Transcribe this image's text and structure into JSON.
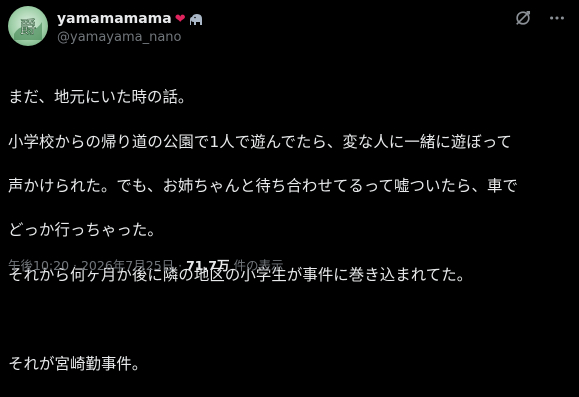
{
  "author": {
    "display_name": "yamamamama",
    "handle": "@yamayama_nano",
    "badges": [
      "heart-icon",
      "elephant-icon"
    ],
    "avatar_text": "爵"
  },
  "actions": {
    "icons": [
      "translate-off-icon",
      "more-icon"
    ],
    "more_label": "···"
  },
  "post": {
    "lines": [
      "まだ、地元にいた時の話。",
      "小学校からの帰り道の公園で1人で遊んでたら、変な人に一緒に遊ぼって",
      "声かけられた。でも、お姉ちゃんと待ち合わせてるって嘘ついたら、車で",
      "どっか行っちゃった。",
      "それから何ヶ月か後に隣の地区の小学生が事件に巻き込まれてた。",
      "",
      "それが宮崎勤事件。"
    ]
  },
  "meta": {
    "time": "午後10:20",
    "separator": "·",
    "date": "2026年7月25日",
    "views_count": "71.7万",
    "views_label": "件の表示"
  },
  "colors": {
    "background": "#000000",
    "text": "#e7e9ea",
    "muted": "#71767b",
    "heart": "#e0245e"
  }
}
